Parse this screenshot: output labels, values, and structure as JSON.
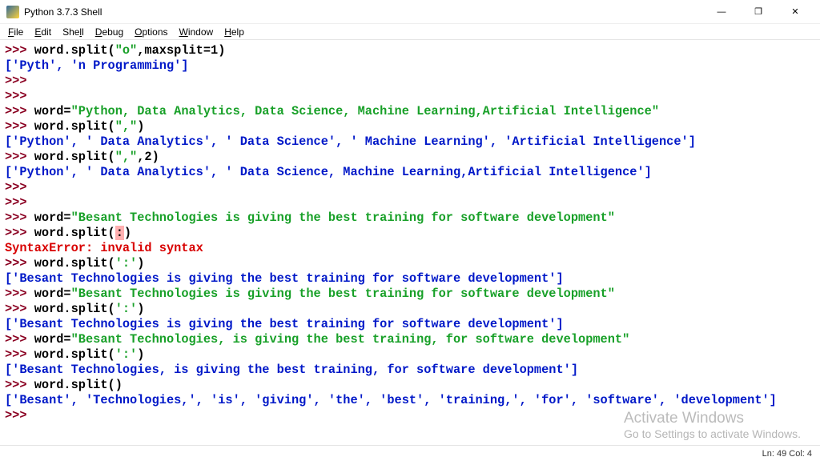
{
  "window": {
    "title": "Python 3.7.3 Shell",
    "minimize": "—",
    "maximize": "❐",
    "close": "✕"
  },
  "menu": {
    "file": {
      "u": "F",
      "rest": "ile"
    },
    "edit": {
      "u": "E",
      "rest": "dit"
    },
    "shell": {
      "pre": "She",
      "u": "l",
      "post": "l"
    },
    "debug": {
      "u": "D",
      "rest": "ebug"
    },
    "options": {
      "u": "O",
      "rest": "ptions"
    },
    "window": {
      "u": "W",
      "rest": "indow"
    },
    "help": {
      "u": "H",
      "rest": "elp"
    }
  },
  "lines": [
    {
      "t": "in",
      "code_pre": "word.split(",
      "str": "\"o\"",
      "code_mid": ",maxsplit=1)"
    },
    {
      "t": "out",
      "text": "['Pyth', 'n Programming']"
    },
    {
      "t": "in"
    },
    {
      "t": "in"
    },
    {
      "t": "in",
      "code_pre": "word=",
      "str": "\"Python, Data Analytics, Data Science, Machine Learning,Artificial Intelligence\""
    },
    {
      "t": "in",
      "code_pre": "word.split(",
      "str": "\",\"",
      "code_mid": ")"
    },
    {
      "t": "out",
      "text": "['Python', ' Data Analytics', ' Data Science', ' Machine Learning', 'Artificial Intelligence']"
    },
    {
      "t": "in",
      "code_pre": "word.split(",
      "str": "\",\"",
      "code_mid": ",2)"
    },
    {
      "t": "out",
      "text": "['Python', ' Data Analytics', ' Data Science, Machine Learning,Artificial Intelligence']"
    },
    {
      "t": "in"
    },
    {
      "t": "in"
    },
    {
      "t": "in",
      "code_pre": "word=",
      "str": "\"Besant Technologies is giving the best training for software development\""
    },
    {
      "t": "in",
      "code_pre": "word.split(",
      "errchar": ":",
      "code_mid": ")"
    },
    {
      "t": "err",
      "text": "SyntaxError: invalid syntax"
    },
    {
      "t": "in",
      "code_pre": "word.split(",
      "str": "':'",
      "code_mid": ")"
    },
    {
      "t": "out",
      "text": "['Besant Technologies is giving the best training for software development']"
    },
    {
      "t": "in",
      "code_pre": "word=",
      "str": "\"Besant Technologies is giving the best training for software development\""
    },
    {
      "t": "in",
      "code_pre": "word.split(",
      "str": "':'",
      "code_mid": ")"
    },
    {
      "t": "out",
      "text": "['Besant Technologies is giving the best training for software development']"
    },
    {
      "t": "in",
      "code_pre": "word=",
      "str": "\"Besant Technologies, is giving the best training, for software development\""
    },
    {
      "t": "in",
      "code_pre": "word.split(",
      "str": "':'",
      "code_mid": ")"
    },
    {
      "t": "out",
      "text": "['Besant Technologies, is giving the best training, for software development']"
    },
    {
      "t": "in",
      "code_pre": "word.split()"
    },
    {
      "t": "out",
      "text": "['Besant', 'Technologies,', 'is', 'giving', 'the', 'best', 'training,', 'for', 'software', 'development']"
    },
    {
      "t": "in"
    }
  ],
  "prompt": ">>> ",
  "status": {
    "text": "Ln: 49  Col: 4"
  },
  "watermark": {
    "title": "Activate Windows",
    "sub": "Go to Settings to activate Windows."
  }
}
